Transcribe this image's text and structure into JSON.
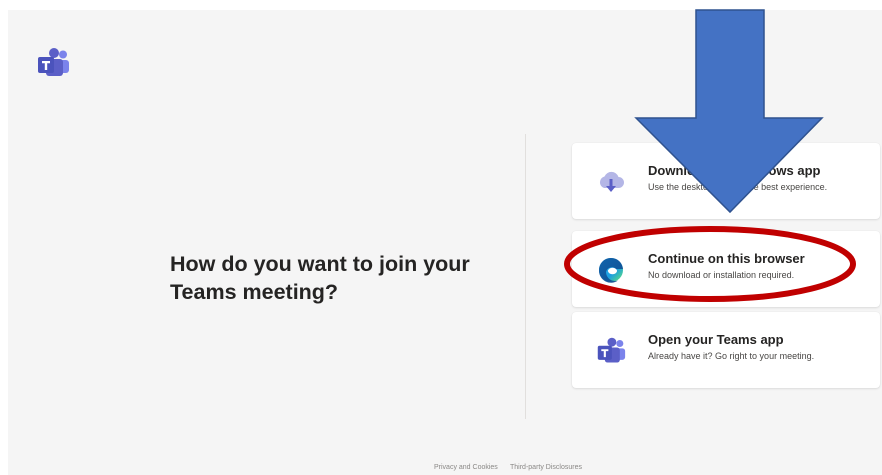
{
  "headline": "How do you want to join your Teams meeting?",
  "options": [
    {
      "title": "Download the Windows app",
      "description": "Use the desktop app for the best experience.",
      "icon": "download-cloud-icon"
    },
    {
      "title": "Continue on this browser",
      "description": "No download or installation required.",
      "icon": "edge-browser-icon"
    },
    {
      "title": "Open your Teams app",
      "description": "Already have it? Go right to your meeting.",
      "icon": "teams-logo-icon"
    }
  ],
  "footer": {
    "privacy": "Privacy and Cookies",
    "third_party": "Third-party Disclosures"
  },
  "colors": {
    "teams_purple": "#5b5fc7",
    "annotation_arrow": "#4472c4",
    "annotation_ellipse": "#c00000",
    "background": "#f5f5f5"
  }
}
